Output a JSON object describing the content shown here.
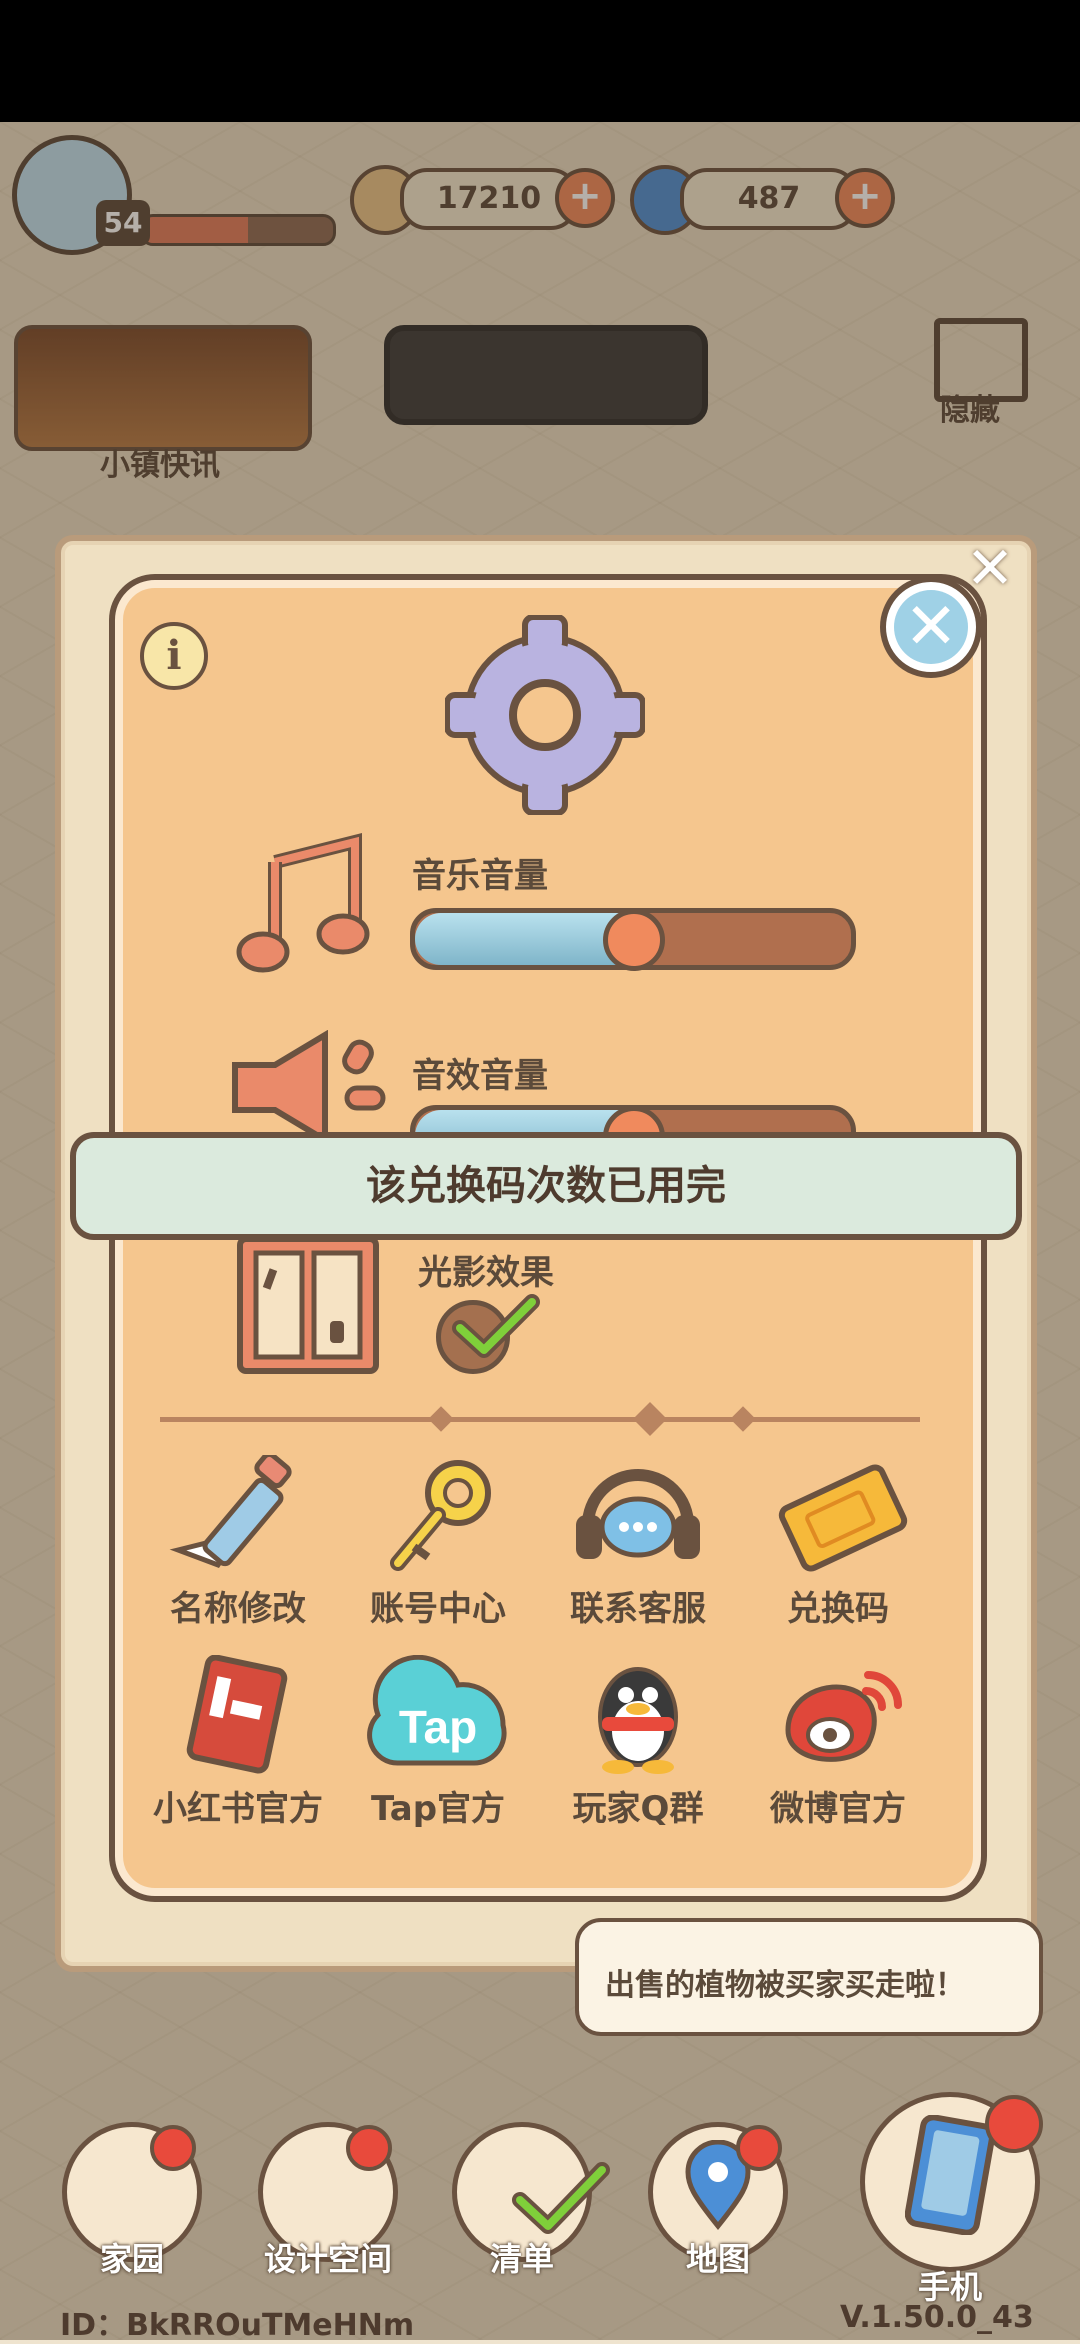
{
  "hud": {
    "level": "54",
    "coins": "17210",
    "gems": "487",
    "news_label": "小镇快讯",
    "hide_label": "隐藏"
  },
  "settings": {
    "music_label": "音乐音量",
    "music_level": 0.5,
    "sfx_label": "音效音量",
    "sfx_level": 0.5,
    "lighting_label": "光影效果",
    "lighting_enabled": true
  },
  "actions": [
    {
      "label": "名称修改",
      "icon": "pencil-icon"
    },
    {
      "label": "账号中心",
      "icon": "key-icon"
    },
    {
      "label": "联系客服",
      "icon": "headset-icon"
    },
    {
      "label": "兑换码",
      "icon": "ticket-icon"
    },
    {
      "label": "小红书官方",
      "icon": "xiaohongshu-icon"
    },
    {
      "label": "Tap官方",
      "icon": "tap-icon"
    },
    {
      "label": "玩家Q群",
      "icon": "qq-penguin-icon"
    },
    {
      "label": "微博官方",
      "icon": "weibo-icon"
    }
  ],
  "toast": "该兑换码次数已用完",
  "tip": "出售的植物被买家买走啦！",
  "nav": [
    {
      "label": "家园"
    },
    {
      "label": "设计空间"
    },
    {
      "label": "清单"
    },
    {
      "label": "地图"
    },
    {
      "label": "手机"
    }
  ],
  "footer": {
    "id": "ID：BkRROuTMeHNm",
    "version": "V.1.50.0_43"
  },
  "colors": {
    "panel": "#f5c68e",
    "outline": "#6a5240",
    "accent": "#f08a5d",
    "toast_bg": "#dbeadd"
  }
}
